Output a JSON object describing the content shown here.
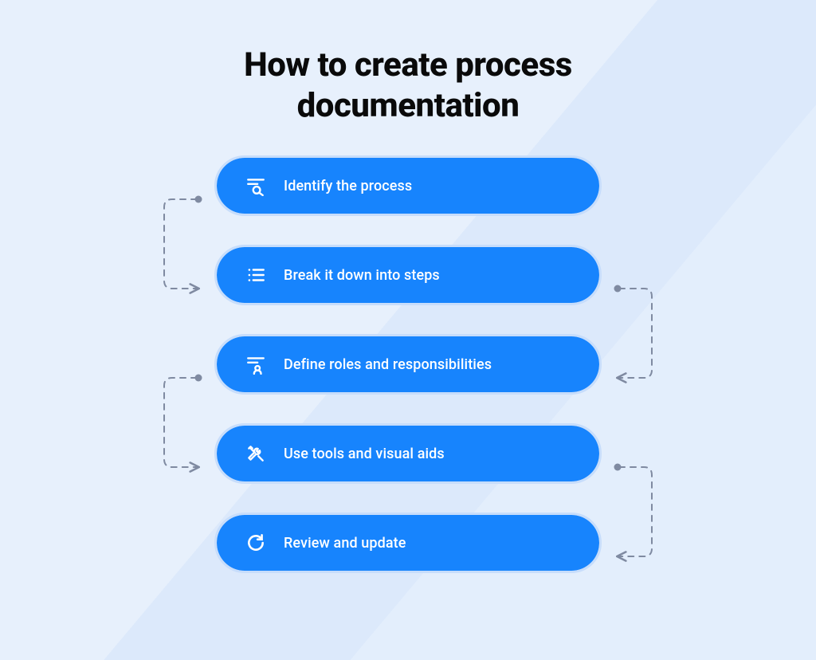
{
  "title": "How to create process documentation",
  "colors": {
    "accent": "#1784fd",
    "pill_outline": "#c7ddfb",
    "connector": "#7f8aa1",
    "text_on_accent": "#ffffff",
    "title_text": "#0a0a0a"
  },
  "steps": [
    {
      "label": "Identify the process",
      "icon_name": "search-lines-icon"
    },
    {
      "label": "Break it down into steps",
      "icon_name": "list-icon"
    },
    {
      "label": "Define roles and responsibilities",
      "icon_name": "person-lines-icon"
    },
    {
      "label": "Use tools and visual aids",
      "icon_name": "tools-icon"
    },
    {
      "label": "Review and update",
      "icon_name": "refresh-icon"
    }
  ],
  "connectors": [
    {
      "from_step": 0,
      "to_step": 1,
      "side": "left"
    },
    {
      "from_step": 1,
      "to_step": 2,
      "side": "right"
    },
    {
      "from_step": 2,
      "to_step": 3,
      "side": "left"
    },
    {
      "from_step": 3,
      "to_step": 4,
      "side": "right"
    }
  ]
}
